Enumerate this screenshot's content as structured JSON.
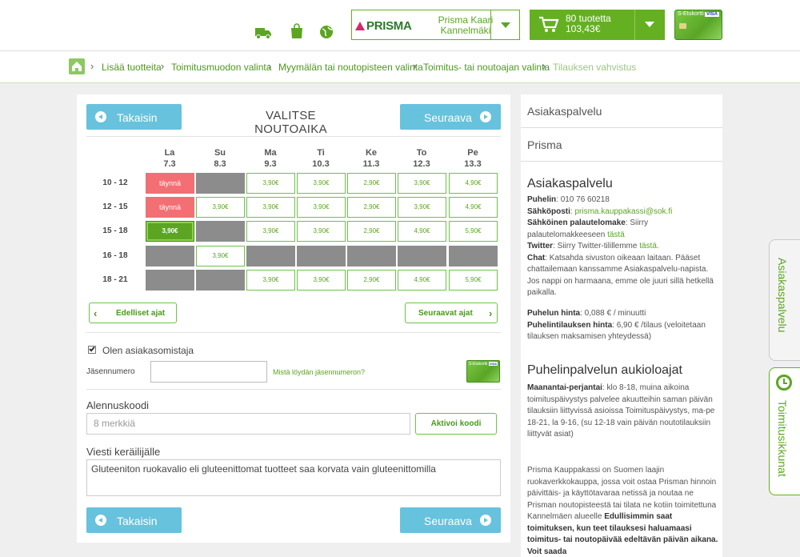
{
  "header": {
    "store": {
      "brand": "PRISMA",
      "name": "Prisma Kaari Kannelmäki"
    },
    "cart": {
      "count": "80 tuotetta",
      "total": "103,43€"
    },
    "card": {
      "label": "S-Etukortti",
      "network": "VISA"
    },
    "icons": [
      "truck-icon",
      "bag-icon",
      "globe-icon",
      "cart-icon"
    ]
  },
  "breadcrumb": [
    "Lisää tuotteita",
    "Toimitusmuodon valinta",
    "Myymälän tai noutopisteen valinta",
    "Toimitus- tai noutoajan valinta",
    "Tilauksen vahvistus"
  ],
  "nav": {
    "back": "Takaisin",
    "next": "Seuraava",
    "title": "VALITSE NOUTOAIKA"
  },
  "schedule": {
    "days": [
      {
        "name": "La",
        "date": "7.3"
      },
      {
        "name": "Su",
        "date": "8.3"
      },
      {
        "name": "Ma",
        "date": "9.3"
      },
      {
        "name": "Ti",
        "date": "10.3"
      },
      {
        "name": "Ke",
        "date": "11.3"
      },
      {
        "name": "To",
        "date": "12.3"
      },
      {
        "name": "Pe",
        "date": "13.3"
      }
    ],
    "rows": [
      {
        "time": "10 - 12",
        "slots": [
          {
            "s": "full",
            "t": "täynnä"
          },
          {
            "s": "na",
            "t": ""
          },
          {
            "s": "open",
            "t": "3,90€"
          },
          {
            "s": "open",
            "t": "3,90€"
          },
          {
            "s": "open",
            "t": "2,90€"
          },
          {
            "s": "open",
            "t": "3,90€"
          },
          {
            "s": "open",
            "t": "4,90€"
          }
        ]
      },
      {
        "time": "12 - 15",
        "slots": [
          {
            "s": "full",
            "t": "täynnä"
          },
          {
            "s": "open",
            "t": "3,90€"
          },
          {
            "s": "open",
            "t": "3,90€"
          },
          {
            "s": "open",
            "t": "3,90€"
          },
          {
            "s": "open",
            "t": "2,90€"
          },
          {
            "s": "open",
            "t": "3,90€"
          },
          {
            "s": "open",
            "t": "4,90€"
          }
        ]
      },
      {
        "time": "15 - 18",
        "slots": [
          {
            "s": "sel",
            "t": "3,90€"
          },
          {
            "s": "na",
            "t": ""
          },
          {
            "s": "open",
            "t": "3,90€"
          },
          {
            "s": "open",
            "t": "3,90€"
          },
          {
            "s": "open",
            "t": "2,90€"
          },
          {
            "s": "open",
            "t": "4,90€"
          },
          {
            "s": "open",
            "t": "5,90€"
          }
        ]
      },
      {
        "time": "16 - 18",
        "slots": [
          {
            "s": "na",
            "t": ""
          },
          {
            "s": "open",
            "t": "3,90€"
          },
          {
            "s": "na",
            "t": ""
          },
          {
            "s": "na",
            "t": ""
          },
          {
            "s": "na",
            "t": ""
          },
          {
            "s": "na",
            "t": ""
          },
          {
            "s": "na",
            "t": ""
          }
        ]
      },
      {
        "time": "18 - 21",
        "slots": [
          {
            "s": "na",
            "t": ""
          },
          {
            "s": "na",
            "t": ""
          },
          {
            "s": "open",
            "t": "3,90€"
          },
          {
            "s": "open",
            "t": "3,90€"
          },
          {
            "s": "open",
            "t": "2,90€"
          },
          {
            "s": "open",
            "t": "4,90€"
          },
          {
            "s": "open",
            "t": "5,90€"
          }
        ]
      }
    ],
    "prev": "Edelliset ajat",
    "next": "Seuraavat ajat"
  },
  "member": {
    "checkbox": "Olen asiakasomistaja",
    "checked": true,
    "number_label": "Jäsennumero",
    "number_value": "",
    "help": "Mistä löydän jäsennumeron?"
  },
  "discount": {
    "label": "Alennuskoodi",
    "placeholder": "8 merkkiä",
    "activate": "Aktivoi koodi"
  },
  "message": {
    "label": "Viesti keräilijälle",
    "value": "Gluteeniton ruokavalio eli gluteenittomat tuotteet saa korvata vain gluteenittomilla"
  },
  "sidebar": {
    "links": [
      "Asiakaspalvelu",
      "Prisma"
    ],
    "cs_title": "Asiakaspalvelu",
    "phone_label": "Puhelin",
    "phone": "010 76 60218",
    "email_label": "Sähköposti",
    "email": "prisma.kauppakassi@sok.fi",
    "feedback_label": "Sähköinen palautelomake",
    "feedback_text": "Siirry palautelomakkeeseen",
    "feedback_link": "tästä",
    "twitter_label": "Twitter",
    "twitter_text": "Siirry Twitter-tilillemme",
    "twitter_link": "tästä.",
    "chat_label": "Chat",
    "chat_text": "Katsahda sivuston oikeaan laitaan. Pääset chattailemaan kanssamme Asiakaspalvelu-napista. Jos nappi on harmaana, emme ole juuri sillä hetkellä paikalla.",
    "price_label": "Puhelun hinta",
    "price": "0,088 € / minuutti",
    "order_price_label": "Puhelintilauksen hinta",
    "order_price": "6,90 € /tilaus (veloitetaan tilauksen maksamisen yhteydessä)",
    "hours_title": "Puhelinpalvelun aukioloajat",
    "hours_label": "Maanantai-perjantai",
    "hours_text": "klo 8-18, muina aikoina toimituspäivystys palvelee akuutteihin saman päivän tilauksiin liittyvissä asioissa Toimituspäivystys, ma-pe 18-21, la 9-16, (su 12-18 vain päivän noutotilauksiin liittyvät asiat)",
    "about": "Prisma Kauppakassi on Suomen laajin ruokaverkkokauppa, jossa voit ostaa Prisman hinnoin päivittäis- ja käyttötavaraa netissä ja noutaa ne Prisman noutopisteestä tai tilata ne kotiin toimitettuna Kannelmäen alueelle",
    "about_bold": "Edullisimmin saat toimituksen, kun teet tilauksesi haluamaasi toimitus- tai noutopäivää edeltävän päivän aikana. Voit saada"
  },
  "tabs": {
    "support": "Asiakaspalvelu",
    "slots": "Toimitusikkunat"
  },
  "colors": {
    "green": "#64b022",
    "blue": "#67c2dd",
    "full": "#f26f73",
    "unavailable": "#8c8c8c"
  }
}
